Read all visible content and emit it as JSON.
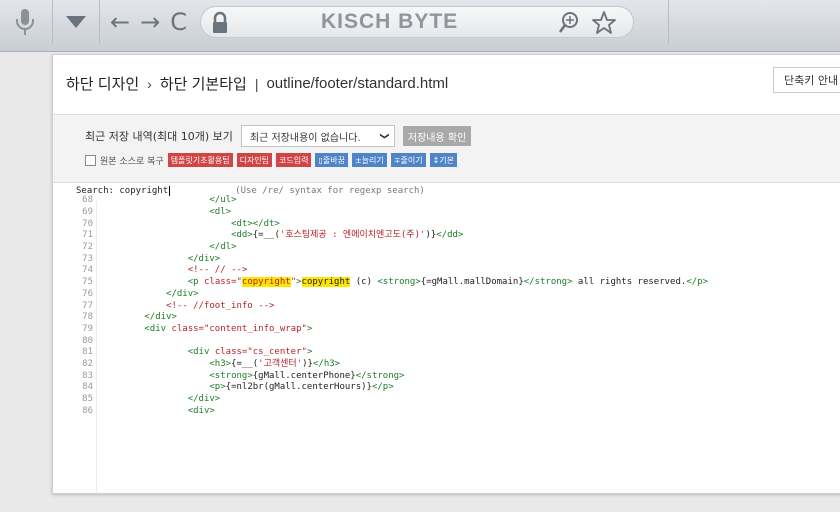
{
  "browser": {
    "site_title": "KISCH BYTE",
    "nav": {
      "back": "←",
      "forward": "→",
      "reload": "C"
    },
    "icons": [
      "mic-icon",
      "dropdown-icon",
      "lock-icon",
      "zoom-icon",
      "star-icon"
    ]
  },
  "header": {
    "crumb1": "하단 디자인",
    "sep1": "›",
    "crumb2": "하단 기본타입",
    "sep2": "|",
    "path": "outline/footer/standard.html",
    "shortcut_btn": "단축키 안내"
  },
  "controls": {
    "history_label": "최근 저장 내역(최대 10개) 보기",
    "history_select": "최근 저장내용이 없습니다.",
    "history_arrow": "❯",
    "confirm_btn": "저장내용 확인",
    "restore_label": "원본 소스로 복구",
    "tags": [
      {
        "label": "템플릿기초활용팁",
        "color": "red"
      },
      {
        "label": "디자인팁",
        "color": "red"
      },
      {
        "label": "코드입력",
        "color": "red"
      },
      {
        "label": "줄바꿈",
        "color": "blue"
      },
      {
        "label": "늘리기",
        "color": "blue"
      },
      {
        "label": "줄이기",
        "color": "blue"
      },
      {
        "label": "기본",
        "color": "blue"
      }
    ]
  },
  "search": {
    "label": "Search: ",
    "value": "copyright",
    "hint": "(Use /re/ syntax for regexp search)"
  },
  "colors": {
    "tag_red": "#d14545",
    "tag_blue": "#4f84c8",
    "highlight": "#ffe600",
    "tag_green": "#1f7b28",
    "string_red": "#b5222a"
  },
  "code_lines": [
    {
      "n": "68",
      "indent": 20,
      "html": "<span class='tg'>&lt;/ul&gt;</span>"
    },
    {
      "n": "69",
      "indent": 20,
      "html": "<span class='tg'>&lt;dl&gt;</span>"
    },
    {
      "n": "70",
      "indent": 24,
      "html": "<span class='tg'>&lt;dt&gt;&lt;/dt&gt;</span>"
    },
    {
      "n": "71",
      "indent": 24,
      "html": "<span class='tg'>&lt;dd&gt;</span>{=__(<span class='str'>'호스팅제공 : 엔에이치엔고도(주)'</span>)}<span class='tg'>&lt;/dd&gt;</span>"
    },
    {
      "n": "72",
      "indent": 20,
      "html": "<span class='tg'>&lt;/dl&gt;</span>"
    },
    {
      "n": "73",
      "indent": 16,
      "html": "<span class='tg'>&lt;/div&gt;</span>"
    },
    {
      "n": "74",
      "indent": 16,
      "html": "<span class='str'>&lt;!-- // --&gt;</span>"
    },
    {
      "n": "75",
      "indent": 16,
      "html": "<span class='tg'>&lt;p </span><span class='str'>class=</span><span class='str'>\"<span class='hl'>copyright</span>\"</span><span class='tg'>&gt;</span><span class='hl'>copyright</span> (c) <span class='tg'>&lt;strong&gt;</span>{=gMall.mallDomain}<span class='tg'>&lt;/strong&gt;</span> all rights reserved.<span class='tg'>&lt;/p&gt;</span>"
    },
    {
      "n": "76",
      "indent": 12,
      "html": "<span class='tg'>&lt;/div&gt;</span>"
    },
    {
      "n": "77",
      "indent": 12,
      "html": "<span class='str'>&lt;!-- //foot_info --&gt;</span>"
    },
    {
      "n": "78",
      "indent": 8,
      "html": "<span class='tg'>&lt;/div&gt;</span>"
    },
    {
      "n": "79",
      "indent": 8,
      "html": "<span class='tg'>&lt;div </span><span class='str'>class=\"content_info_wrap\"</span><span class='tg'>&gt;</span>"
    },
    {
      "n": "80",
      "indent": 0,
      "html": ""
    },
    {
      "n": "81",
      "indent": 16,
      "html": "<span class='tg'>&lt;div </span><span class='str'>class=\"cs_center\"</span><span class='tg'>&gt;</span>"
    },
    {
      "n": "82",
      "indent": 20,
      "html": "<span class='tg'>&lt;h3&gt;</span>{=__(<span class='str'>'고객센터'</span>)}<span class='tg'>&lt;/h3&gt;</span>"
    },
    {
      "n": "83",
      "indent": 20,
      "html": "<span class='tg'>&lt;strong&gt;</span>{gMall.centerPhone}<span class='tg'>&lt;/strong&gt;</span>"
    },
    {
      "n": "84",
      "indent": 20,
      "html": "<span class='tg'>&lt;p&gt;</span>{=nl2br(gMall.centerHours)}<span class='tg'>&lt;/p&gt;</span>"
    },
    {
      "n": "85",
      "indent": 16,
      "html": "<span class='tg'>&lt;/div&gt;</span>"
    },
    {
      "n": "86",
      "indent": 16,
      "html": "<span class='tg'>&lt;div&gt;</span>"
    }
  ]
}
